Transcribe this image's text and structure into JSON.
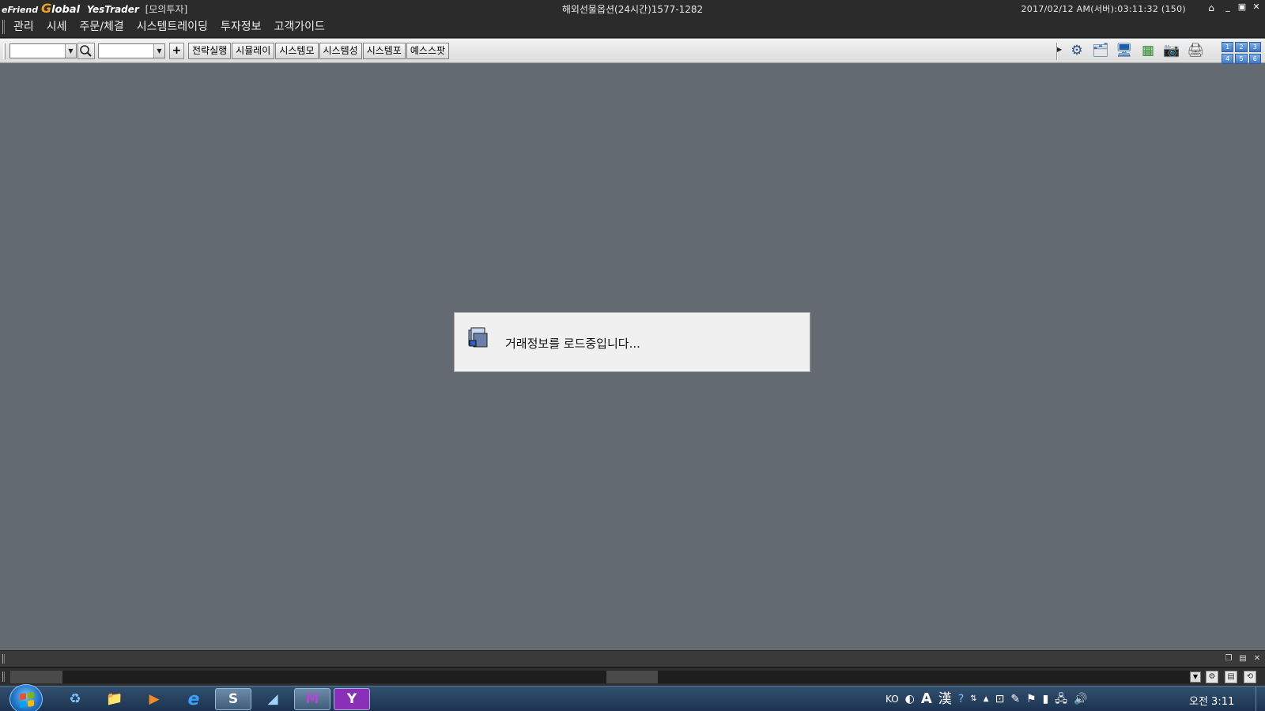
{
  "titlebar": {
    "logo_efriend": "eFriend",
    "logo_g": "G",
    "logo_global": "lobal",
    "logo_yestrader": "YesTrader",
    "mode": "[모의투자]",
    "center": "해외선물옵션(24시간)1577-1282",
    "datetime": "2017/02/12  AM(서버):03:11:32 (150)",
    "home": "⌂",
    "minimize": "_",
    "restore": "▣",
    "close": "✕"
  },
  "menu": [
    "관리",
    "시세",
    "주문/체결",
    "시스템트레이딩",
    "투자정보",
    "고객가이드"
  ],
  "toolbar": {
    "combo_arrow": "▼",
    "search": "🔍",
    "plus": "+",
    "sys_buttons": [
      "전략실행",
      "시뮬레이",
      "시스템모",
      "시스템성",
      "시스템포",
      "예스스팟"
    ],
    "tool_icons": [
      "⚙",
      "🗂",
      "🖥",
      "▦",
      "📷",
      "🖨"
    ],
    "grid_labels": [
      "1",
      "2",
      "3",
      "4",
      "5",
      "6"
    ]
  },
  "dialog": {
    "message": "거래정보를 로드중입니다..."
  },
  "statusbar": {
    "buttons": [
      "❐",
      "▤",
      "✕"
    ]
  },
  "ticker": {
    "dropdown": "▼",
    "icons": [
      "⚙",
      "▤",
      "⟲"
    ]
  },
  "taskbar": {
    "tasks": [
      "♻",
      "📁",
      "▶",
      "e",
      "S",
      "◢",
      "M",
      "Y"
    ],
    "lang": "KO",
    "tray": [
      "◐",
      "A",
      "漢",
      "?",
      "⇅",
      "▲",
      "⊡",
      "✎",
      "⚑",
      "▮",
      "🖧",
      "🔊"
    ],
    "clock": "오전 3:11"
  },
  "colors": {
    "workspace": "#646a72",
    "titlebar": "#2b2b2b",
    "logo_accent": "#f0a020"
  }
}
